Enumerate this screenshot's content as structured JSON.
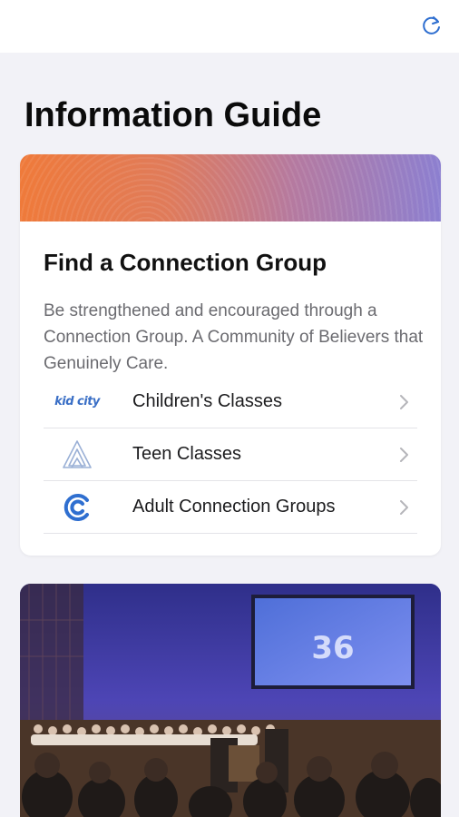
{
  "header": {
    "refresh_icon": "refresh-icon"
  },
  "page": {
    "title": "Information Guide"
  },
  "card": {
    "title": "Find a Connection Group",
    "description": "Be strengthened and encouraged through a Connection Group. A Community of Believers that Genuinely Care.",
    "items": [
      {
        "label": "Children's Classes",
        "icon": "kidcity-logo",
        "logo_text": "kid city"
      },
      {
        "label": "Teen Classes",
        "icon": "teen-triangle-logo"
      },
      {
        "label": "Adult Connection Groups",
        "icon": "adult-c-logo"
      }
    ]
  },
  "photo": {
    "screen_text": "36"
  },
  "colors": {
    "accent": "#2f6fd0",
    "banner_start": "#ef7a3a",
    "banner_end": "#8c7fd0"
  }
}
